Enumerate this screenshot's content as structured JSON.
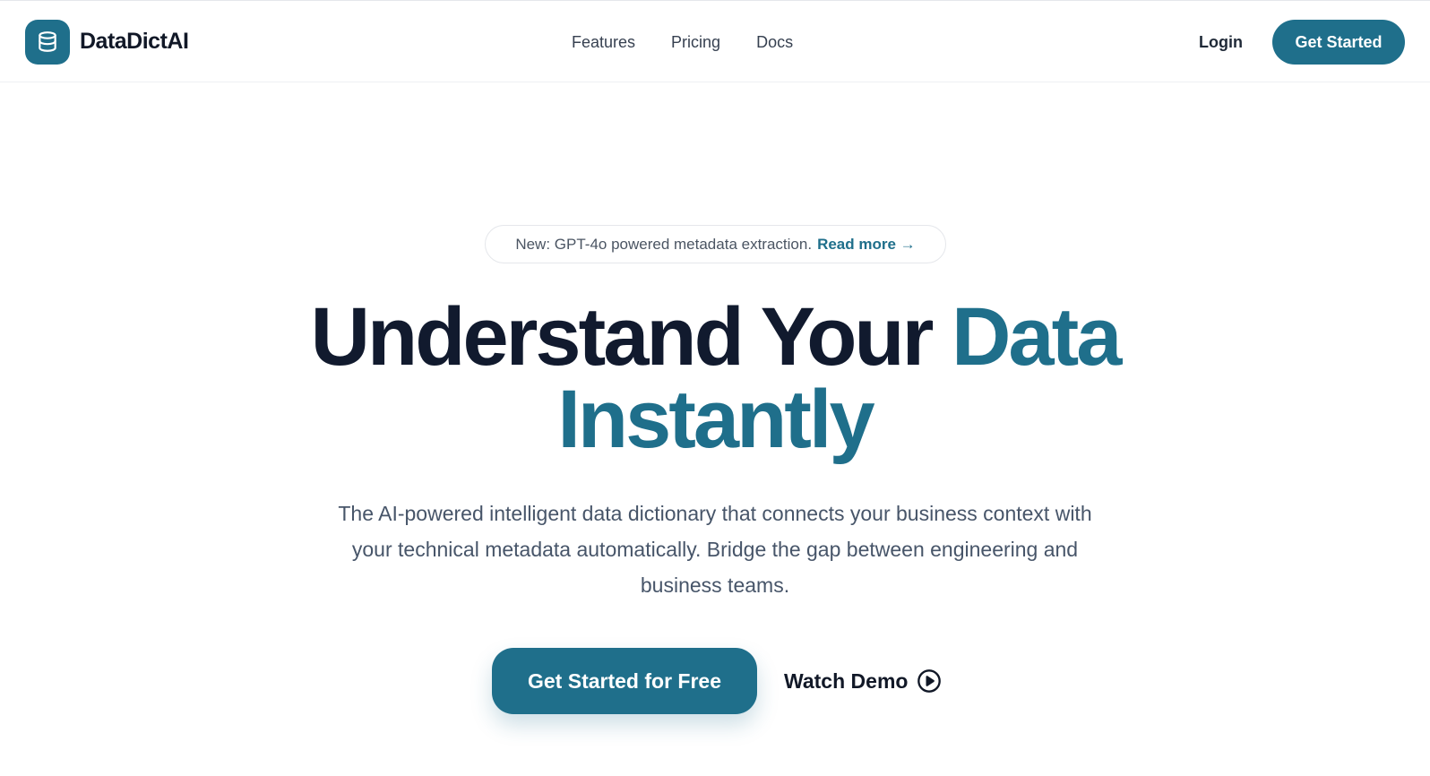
{
  "brand": {
    "name": "DataDictAI",
    "icon": "database-icon"
  },
  "nav": {
    "items": [
      "Features",
      "Pricing",
      "Docs"
    ]
  },
  "header": {
    "login_label": "Login",
    "cta_label": "Get Started"
  },
  "announcement": {
    "text": "New: GPT-4o powered metadata extraction.",
    "link_label": "Read more →"
  },
  "hero": {
    "headline_part1": "Understand Your ",
    "headline_accent1": "Data",
    "headline_accent2": "Instantly",
    "subtitle": "The AI-powered intelligent data dictionary that connects your business context with your technical metadata automatically. Bridge the gap between engineering and business teams.",
    "primary_cta": "Get Started for Free",
    "secondary_cta": "Watch Demo",
    "secondary_icon": "play-circle-icon"
  },
  "colors": {
    "accent": "#1f6f8b",
    "heading": "#111a2e",
    "body": "#475569"
  }
}
